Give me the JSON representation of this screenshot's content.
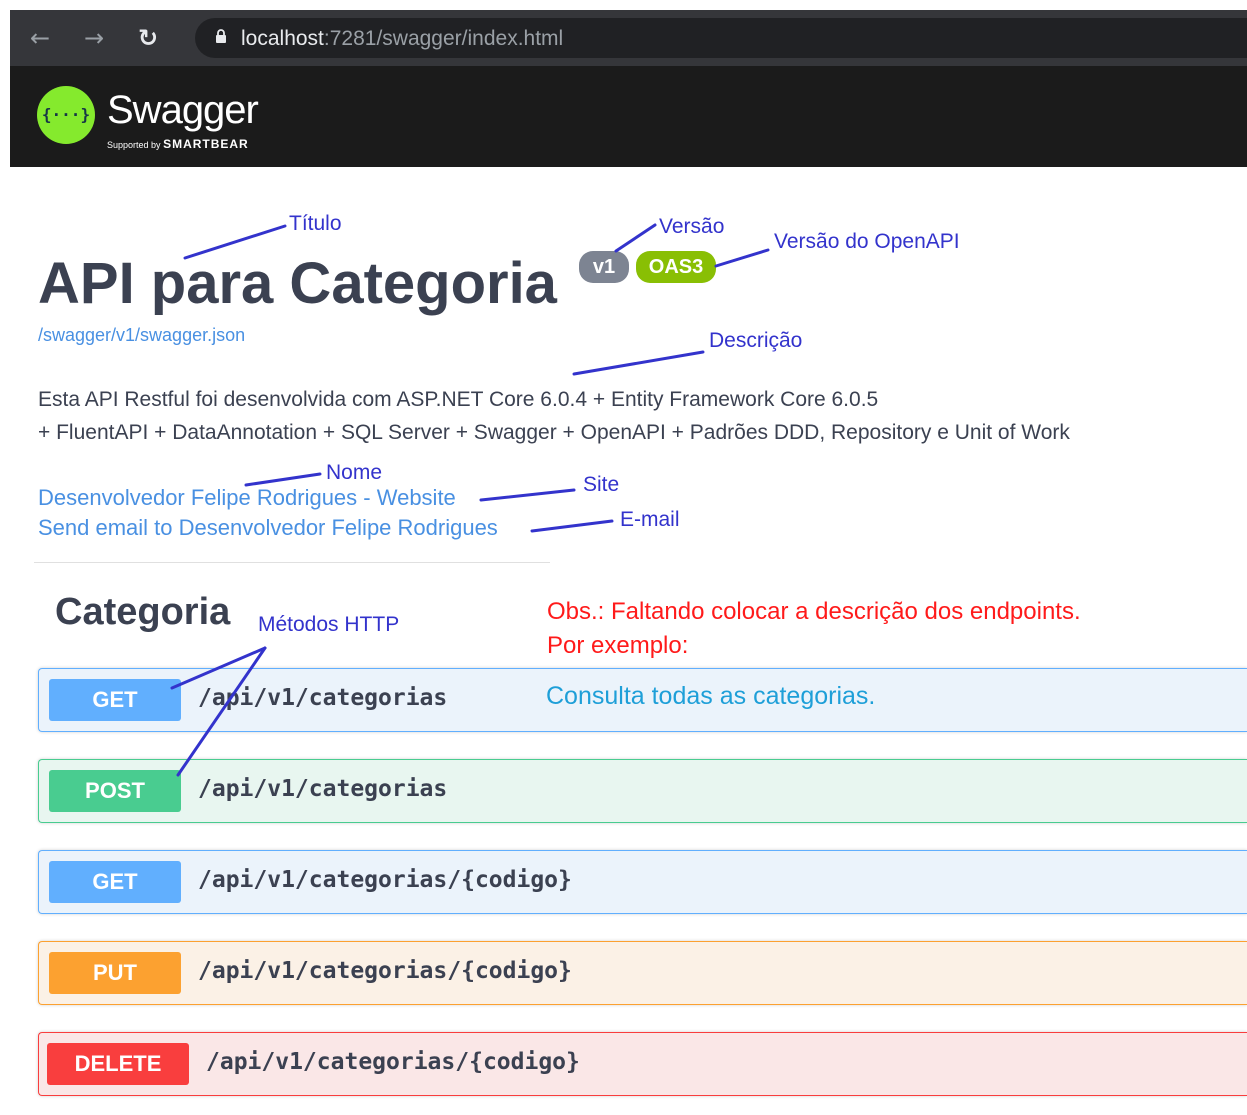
{
  "browser": {
    "back_icon": "arrow-left-icon",
    "forward_icon": "arrow-right-icon",
    "reload_icon": "reload-icon",
    "url_host": "localhost",
    "url_rest": ":7281/swagger/index.html"
  },
  "topbar": {
    "logo_glyph": "{···}",
    "brand": "Swagger",
    "supported_by": "Supported by",
    "company": "SMARTBEAR"
  },
  "info": {
    "title": "API para Categoria",
    "version": "v1",
    "oas": "OAS3",
    "spec_url": "/swagger/v1/swagger.json",
    "description_lines": [
      "Esta API Restful foi desenvolvida com ASP.NET Core 6.0.4 + Entity Framework Core 6.0.5",
      "+ FluentAPI + DataAnnotation + SQL Server + Swagger + OpenAPI + Padrões DDD, Repository e Unit of Work"
    ],
    "contact_website": "Desenvolvedor Felipe Rodrigues - Website",
    "contact_email": "Send email to Desenvolvedor Felipe Rodrigues"
  },
  "annotations": {
    "titulo": "Título",
    "versao": "Versão",
    "versao_openapi": "Versão do OpenAPI",
    "descricao": "Descrição",
    "nome": "Nome",
    "site": "Site",
    "email": "E-mail",
    "metodos_http": "Métodos HTTP",
    "obs_line1": "Obs.: Faltando colocar a descrição dos endpoints.",
    "obs_line2": "Por exemplo:",
    "consulta": "Consulta todas as categorias."
  },
  "tag": {
    "name": "Categoria"
  },
  "operations": [
    {
      "method": "GET",
      "path": "/api/v1/categorias",
      "color": "#61affe"
    },
    {
      "method": "POST",
      "path": "/api/v1/categorias",
      "color": "#49cc90"
    },
    {
      "method": "GET",
      "path": "/api/v1/categorias/{codigo}",
      "color": "#61affe"
    },
    {
      "method": "PUT",
      "path": "/api/v1/categorias/{codigo}",
      "color": "#fca130"
    },
    {
      "method": "DELETE",
      "path": "/api/v1/categorias/{codigo}",
      "color": "#f93e3e"
    }
  ]
}
